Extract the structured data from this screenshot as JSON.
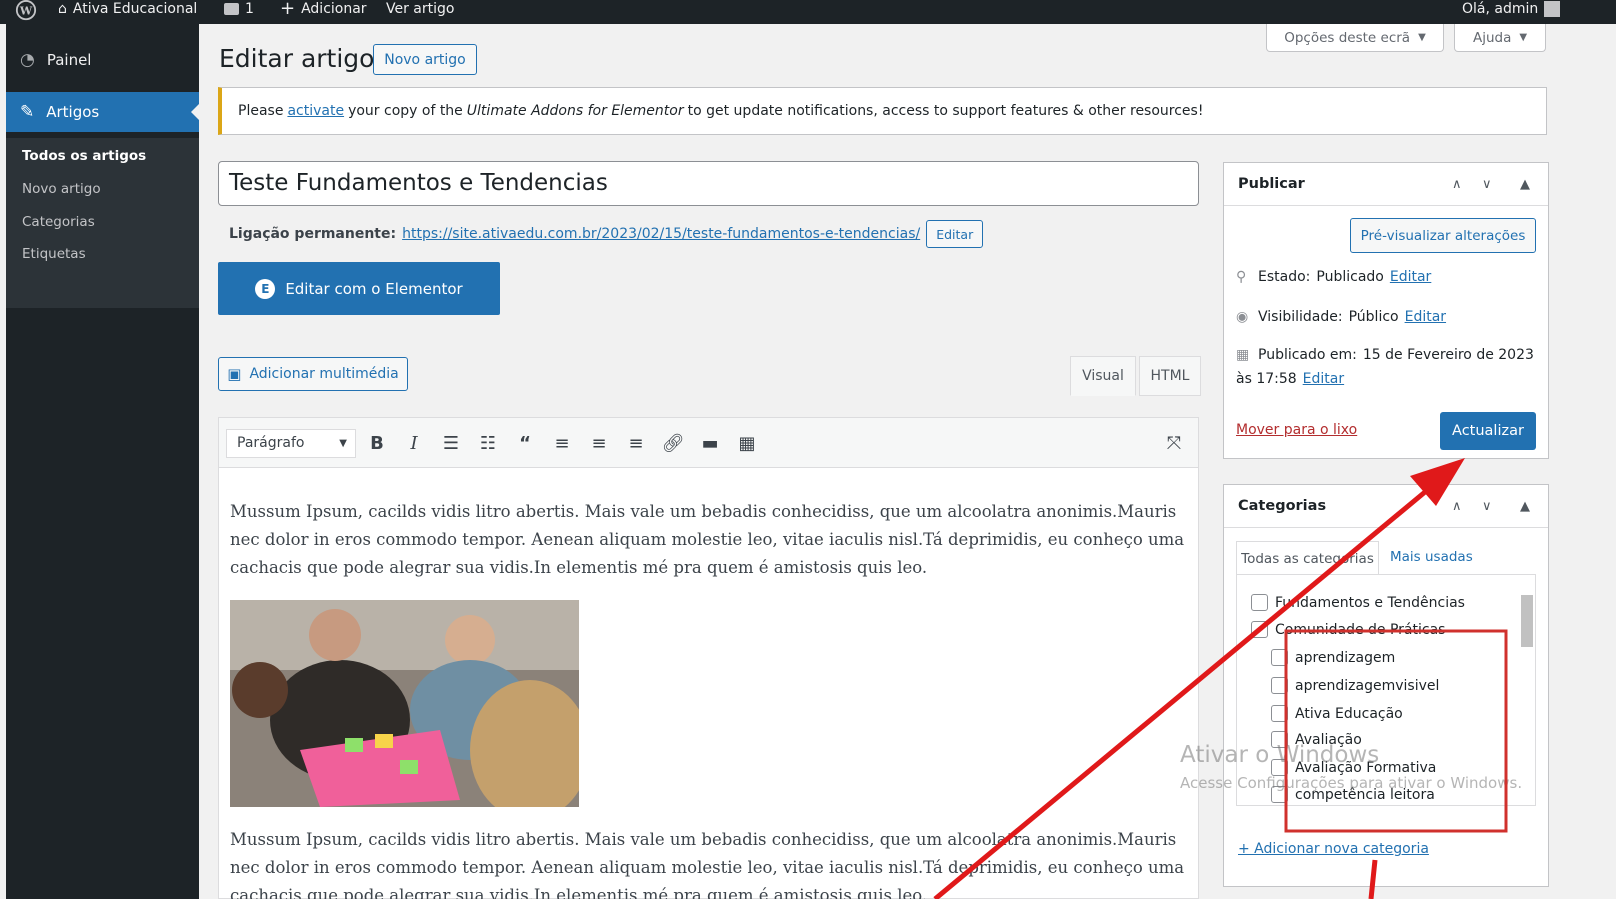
{
  "adminbar": {
    "site_name": "Ativa Educacional",
    "comments_count": "1",
    "add_label": "Adicionar",
    "view_label": "Ver artigo",
    "greeting": "Olá, admin"
  },
  "sidebar": {
    "dashboard_label": "Painel",
    "posts_label": "Artigos",
    "submenu": [
      "Todos os artigos",
      "Novo artigo",
      "Categorias",
      "Etiquetas"
    ]
  },
  "header": {
    "title": "Editar artigo",
    "new_button": "Novo artigo",
    "screen_options": "Opções deste ecrã",
    "help": "Ajuda"
  },
  "notice": {
    "before": "Please",
    "link": "activate",
    "middle": "your copy of the",
    "product": "Ultimate Addons for Elementor",
    "after": "to get update notifications, access to support features & other resources!"
  },
  "post": {
    "title": "Teste Fundamentos e Tendencias",
    "permalink_label": "Ligação permanente:",
    "permalink_url": "https://site.ativaedu.com.br/2023/02/15/teste-fundamentos-e-tendencias/",
    "permalink_edit": "Editar",
    "elementor_button": "Editar com o Elementor",
    "add_media": "Adicionar multimédia",
    "tab_visual": "Visual",
    "tab_html": "HTML",
    "format_select": "Parágrafo",
    "paragraph1": "Mussum Ipsum, cacilds vidis litro abertis. Mais vale um bebadis conhecidiss, que um alcoolatra anonimis.Mauris nec dolor in eros commodo tempor. Aenean aliquam molestie leo, vitae iaculis nisl.Tá deprimidis, eu conheço uma cachacis que pode alegrar sua vidis.In elementis mé pra quem é amistosis quis leo.",
    "paragraph2": "Mussum Ipsum, cacilds vidis litro abertis. Mais vale um bebadis conhecidiss, que um alcoolatra anonimis.Mauris nec dolor in eros commodo tempor. Aenean aliquam molestie leo, vitae iaculis nisl.Tá deprimidis, eu conheço uma cachacis que pode alegrar sua vidis.In elementis mé pra quem é amistosis quis leo."
  },
  "publish": {
    "title": "Publicar",
    "preview": "Pré-visualizar alterações",
    "status_label": "Estado:",
    "status_value": "Publicado",
    "visibility_label": "Visibilidade:",
    "visibility_value": "Público",
    "published_label": "Publicado em:",
    "published_date": "15 de Fevereiro de 2023",
    "published_time": "às 17:58",
    "edit": "Editar",
    "trash": "Mover para o lixo",
    "update": "Actualizar"
  },
  "categories": {
    "title": "Categorias",
    "tab_all": "Todas as categorias",
    "tab_most": "Mais usadas",
    "items": [
      {
        "label": "Fundamentos e Tendências",
        "checked": false
      },
      {
        "label": "Comunidade de Práticas",
        "checked": true
      },
      {
        "label": "aprendizagem",
        "checked": false
      },
      {
        "label": "aprendizagemvisivel",
        "checked": false
      },
      {
        "label": "Ativa Educação",
        "checked": false
      },
      {
        "label": "Avaliação",
        "checked": false
      },
      {
        "label": "Avaliação Formativa",
        "checked": false
      },
      {
        "label": "competência leitora",
        "checked": false
      }
    ],
    "add_new": "+ Adicionar nova categoria"
  },
  "watermark": {
    "line1": "Ativar o Windows",
    "line2": "Acesse Configurações para ativar o Windows."
  },
  "colors": {
    "accent": "#2271b1",
    "adminbar": "#1d2327",
    "annotation": "#e0191a"
  }
}
